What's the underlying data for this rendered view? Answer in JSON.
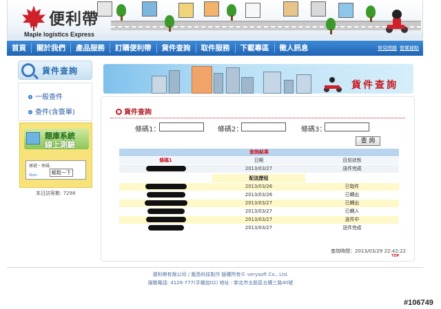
{
  "brand": {
    "title": "便利帶",
    "subtitle": "Maple logistics Express"
  },
  "nav": {
    "items": [
      "首頁",
      "關於我們",
      "產品服務",
      "訂購便利帶",
      "貨件查詢",
      "取件服務",
      "下載專區",
      "徵人訊息"
    ],
    "links": [
      "常見問題",
      "營業據點"
    ]
  },
  "sidebar": {
    "heading": "貨件查詢",
    "items": [
      "一般查件",
      "查件(含簽單)"
    ],
    "promo": {
      "line1": "題庫系統",
      "line2": "線上測驗",
      "box_text": "帳號・密碼",
      "box_button": "輕鬆一下",
      "box_brand": "iSchi"
    },
    "visits": "本日訪客數: 7298"
  },
  "banner": {
    "title": "貨件查詢"
  },
  "panel": {
    "title": "貨件查詢",
    "queries": [
      {
        "label": "條碼1：",
        "value": ""
      },
      {
        "label": "條碼2：",
        "value": ""
      },
      {
        "label": "條碼3：",
        "value": ""
      }
    ],
    "button": "查 詢"
  },
  "results": {
    "title": "查詢結果",
    "headers": [
      "條碼1",
      "日期",
      "目前狀態"
    ],
    "summary": {
      "date": "2013/03/27",
      "status": "送件完成"
    },
    "history_title": "配送歷程",
    "history": [
      {
        "date": "2013/03/26",
        "status": "已取件"
      },
      {
        "date": "2013/03/26",
        "status": "已轉出"
      },
      {
        "date": "2013/03/27",
        "status": "已轉出"
      },
      {
        "date": "2013/03/27",
        "status": "已轉入"
      },
      {
        "date": "2013/03/27",
        "status": "送件中"
      },
      {
        "date": "2013/03/27",
        "status": "送件完成"
      }
    ],
    "query_time": "查詢時間：2013/03/29 22:42:22",
    "top": "TOP"
  },
  "footer": {
    "line1": "便利帶有限公司 / 鳳島科技製作 版權所有© verysoft Co., Ltd.",
    "line2": "服務電話: 4128-777(手機加02) 地址 : 新北市五股區五權三路40號"
  },
  "watermark": "#106749",
  "colors": {
    "nav": "#1f64b4",
    "accent_red": "#c8161d",
    "table_header": "#b9d4ee",
    "row_highlight": "#fff8c8"
  }
}
